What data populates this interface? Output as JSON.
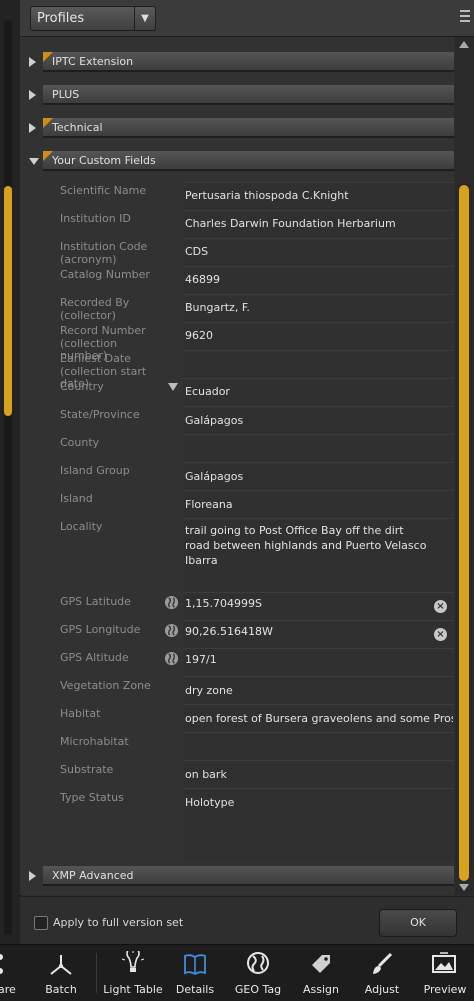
{
  "toolbar": {
    "profiles_label": "Profiles"
  },
  "sections": {
    "iptc": "IPTC Extension",
    "plus": "PLUS",
    "technical": "Technical",
    "custom": "Your Custom Fields",
    "xmp": "XMP Advanced"
  },
  "fields": {
    "scientific_name": {
      "label": "Scientific Name",
      "value": "Pertusaria thiospoda C.Knight"
    },
    "institution_id": {
      "label": "Institution ID",
      "value": "Charles Darwin Foundation Herbarium"
    },
    "institution_code": {
      "label": "Institution Code (acronym)",
      "value": "CDS"
    },
    "catalog_number": {
      "label": "Catalog Number",
      "value": "46899"
    },
    "recorded_by": {
      "label": "Recorded By (collector)",
      "value": "Bungartz, F."
    },
    "record_number": {
      "label": "Record Number (collection number)",
      "value": "9620"
    },
    "earliest_date": {
      "label": "Earliest Date (collection start date)",
      "value": ""
    },
    "country": {
      "label": "Country",
      "value": "Ecuador"
    },
    "state": {
      "label": "State/Province",
      "value": "Galápagos"
    },
    "county": {
      "label": "County",
      "value": ""
    },
    "island_group": {
      "label": "Island Group",
      "value": "Galápagos"
    },
    "island": {
      "label": "Island",
      "value": "Floreana"
    },
    "locality": {
      "label": "Locality",
      "value": "trail going to Post Office Bay off the dirt road between highlands and Puerto Velasco Ibarra"
    },
    "gps_lat": {
      "label": "GPS Latitude",
      "value": "1,15.704999S"
    },
    "gps_lon": {
      "label": "GPS Longitude",
      "value": "90,26.516418W"
    },
    "gps_alt": {
      "label": "GPS Altitude",
      "value": "197/1"
    },
    "vegetation": {
      "label": "Vegetation Zone",
      "value": "dry zone"
    },
    "habitat": {
      "label": "Habitat",
      "value": "open forest of Bursera graveolens and some Prosop"
    },
    "microhabitat": {
      "label": "Microhabitat",
      "value": ""
    },
    "substrate": {
      "label": "Substrate",
      "value": "on bark"
    },
    "type_status": {
      "label": "Type Status",
      "value": "Holotype"
    }
  },
  "actions": {
    "apply_label": "Apply to full version set",
    "ok_label": "OK"
  },
  "tabs": [
    {
      "label": "are",
      "icon": "share-icon"
    },
    {
      "label": "Batch",
      "icon": "batch-icon"
    },
    {
      "label": "Light Table",
      "icon": "light-table-icon"
    },
    {
      "label": "Details",
      "icon": "details-book-icon"
    },
    {
      "label": "GEO Tag",
      "icon": "globe-icon"
    },
    {
      "label": "Assign",
      "icon": "tag-icon"
    },
    {
      "label": "Adjust",
      "icon": "brush-icon"
    },
    {
      "label": "Preview",
      "icon": "preview-icon"
    }
  ],
  "colors": {
    "accent": "#d8a21c",
    "section_corner": "#d38d14",
    "active_tab_icon": "#3e8ed8"
  }
}
